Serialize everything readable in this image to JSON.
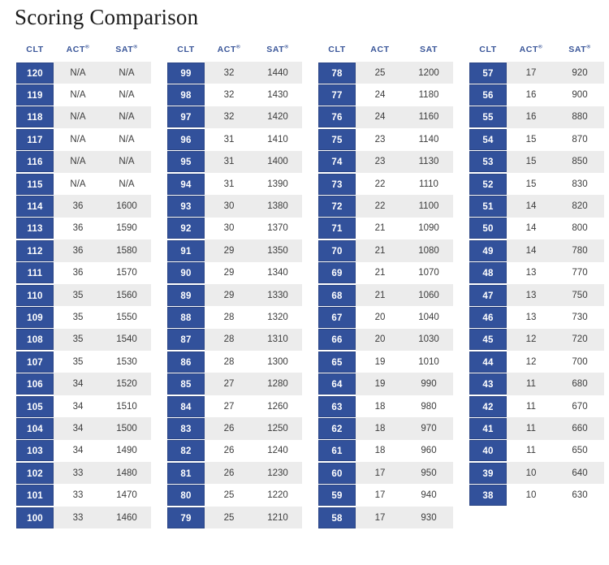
{
  "page": {
    "title": "Scoring Comparison"
  },
  "tables": [
    {
      "id": "table-1",
      "headers": {
        "clt": "CLT",
        "act": "ACT",
        "act_reg": "®",
        "sat": "SAT",
        "sat_reg": "®"
      },
      "act_registered": true,
      "sat_registered": true,
      "rows": [
        {
          "clt": "120",
          "act": "N/A",
          "sat": "N/A"
        },
        {
          "clt": "119",
          "act": "N/A",
          "sat": "N/A"
        },
        {
          "clt": "118",
          "act": "N/A",
          "sat": "N/A"
        },
        {
          "clt": "117",
          "act": "N/A",
          "sat": "N/A"
        },
        {
          "clt": "116",
          "act": "N/A",
          "sat": "N/A"
        },
        {
          "clt": "115",
          "act": "N/A",
          "sat": "N/A"
        },
        {
          "clt": "114",
          "act": "36",
          "sat": "1600"
        },
        {
          "clt": "113",
          "act": "36",
          "sat": "1590"
        },
        {
          "clt": "112",
          "act": "36",
          "sat": "1580"
        },
        {
          "clt": "111",
          "act": "36",
          "sat": "1570"
        },
        {
          "clt": "110",
          "act": "35",
          "sat": "1560"
        },
        {
          "clt": "109",
          "act": "35",
          "sat": "1550"
        },
        {
          "clt": "108",
          "act": "35",
          "sat": "1540"
        },
        {
          "clt": "107",
          "act": "35",
          "sat": "1530"
        },
        {
          "clt": "106",
          "act": "34",
          "sat": "1520"
        },
        {
          "clt": "105",
          "act": "34",
          "sat": "1510"
        },
        {
          "clt": "104",
          "act": "34",
          "sat": "1500"
        },
        {
          "clt": "103",
          "act": "34",
          "sat": "1490"
        },
        {
          "clt": "102",
          "act": "33",
          "sat": "1480"
        },
        {
          "clt": "101",
          "act": "33",
          "sat": "1470"
        },
        {
          "clt": "100",
          "act": "33",
          "sat": "1460"
        }
      ]
    },
    {
      "id": "table-2",
      "headers": {
        "clt": "CLT",
        "act": "ACT",
        "act_reg": "®",
        "sat": "SAT",
        "sat_reg": "®"
      },
      "act_registered": true,
      "sat_registered": true,
      "rows": [
        {
          "clt": "99",
          "act": "32",
          "sat": "1440"
        },
        {
          "clt": "98",
          "act": "32",
          "sat": "1430"
        },
        {
          "clt": "97",
          "act": "32",
          "sat": "1420"
        },
        {
          "clt": "96",
          "act": "31",
          "sat": "1410"
        },
        {
          "clt": "95",
          "act": "31",
          "sat": "1400"
        },
        {
          "clt": "94",
          "act": "31",
          "sat": "1390"
        },
        {
          "clt": "93",
          "act": "30",
          "sat": "1380"
        },
        {
          "clt": "92",
          "act": "30",
          "sat": "1370"
        },
        {
          "clt": "91",
          "act": "29",
          "sat": "1350"
        },
        {
          "clt": "90",
          "act": "29",
          "sat": "1340"
        },
        {
          "clt": "89",
          "act": "29",
          "sat": "1330"
        },
        {
          "clt": "88",
          "act": "28",
          "sat": "1320"
        },
        {
          "clt": "87",
          "act": "28",
          "sat": "1310"
        },
        {
          "clt": "86",
          "act": "28",
          "sat": "1300"
        },
        {
          "clt": "85",
          "act": "27",
          "sat": "1280"
        },
        {
          "clt": "84",
          "act": "27",
          "sat": "1260"
        },
        {
          "clt": "83",
          "act": "26",
          "sat": "1250"
        },
        {
          "clt": "82",
          "act": "26",
          "sat": "1240"
        },
        {
          "clt": "81",
          "act": "26",
          "sat": "1230"
        },
        {
          "clt": "80",
          "act": "25",
          "sat": "1220"
        },
        {
          "clt": "79",
          "act": "25",
          "sat": "1210"
        }
      ]
    },
    {
      "id": "table-3",
      "headers": {
        "clt": "CLT",
        "act": "ACT",
        "act_reg": "",
        "sat": "SAT",
        "sat_reg": ""
      },
      "act_registered": false,
      "sat_registered": false,
      "rows": [
        {
          "clt": "78",
          "act": "25",
          "sat": "1200"
        },
        {
          "clt": "77",
          "act": "24",
          "sat": "1180"
        },
        {
          "clt": "76",
          "act": "24",
          "sat": "1160"
        },
        {
          "clt": "75",
          "act": "23",
          "sat": "1140"
        },
        {
          "clt": "74",
          "act": "23",
          "sat": "1130"
        },
        {
          "clt": "73",
          "act": "22",
          "sat": "1110"
        },
        {
          "clt": "72",
          "act": "22",
          "sat": "1100"
        },
        {
          "clt": "71",
          "act": "21",
          "sat": "1090"
        },
        {
          "clt": "70",
          "act": "21",
          "sat": "1080"
        },
        {
          "clt": "69",
          "act": "21",
          "sat": "1070"
        },
        {
          "clt": "68",
          "act": "21",
          "sat": "1060"
        },
        {
          "clt": "67",
          "act": "20",
          "sat": "1040"
        },
        {
          "clt": "66",
          "act": "20",
          "sat": "1030"
        },
        {
          "clt": "65",
          "act": "19",
          "sat": "1010"
        },
        {
          "clt": "64",
          "act": "19",
          "sat": "990"
        },
        {
          "clt": "63",
          "act": "18",
          "sat": "980"
        },
        {
          "clt": "62",
          "act": "18",
          "sat": "970"
        },
        {
          "clt": "61",
          "act": "18",
          "sat": "960"
        },
        {
          "clt": "60",
          "act": "17",
          "sat": "950"
        },
        {
          "clt": "59",
          "act": "17",
          "sat": "940"
        },
        {
          "clt": "58",
          "act": "17",
          "sat": "930"
        }
      ]
    },
    {
      "id": "table-4",
      "headers": {
        "clt": "CLT",
        "act": "ACT",
        "act_reg": "®",
        "sat": "SAT",
        "sat_reg": "®"
      },
      "act_registered": true,
      "sat_registered": true,
      "rows": [
        {
          "clt": "57",
          "act": "17",
          "sat": "920"
        },
        {
          "clt": "56",
          "act": "16",
          "sat": "900"
        },
        {
          "clt": "55",
          "act": "16",
          "sat": "880"
        },
        {
          "clt": "54",
          "act": "15",
          "sat": "870"
        },
        {
          "clt": "53",
          "act": "15",
          "sat": "850"
        },
        {
          "clt": "52",
          "act": "15",
          "sat": "830"
        },
        {
          "clt": "51",
          "act": "14",
          "sat": "820"
        },
        {
          "clt": "50",
          "act": "14",
          "sat": "800"
        },
        {
          "clt": "49",
          "act": "14",
          "sat": "780"
        },
        {
          "clt": "48",
          "act": "13",
          "sat": "770"
        },
        {
          "clt": "47",
          "act": "13",
          "sat": "750"
        },
        {
          "clt": "46",
          "act": "13",
          "sat": "730"
        },
        {
          "clt": "45",
          "act": "12",
          "sat": "720"
        },
        {
          "clt": "44",
          "act": "12",
          "sat": "700"
        },
        {
          "clt": "43",
          "act": "11",
          "sat": "680"
        },
        {
          "clt": "42",
          "act": "11",
          "sat": "670"
        },
        {
          "clt": "41",
          "act": "11",
          "sat": "660"
        },
        {
          "clt": "40",
          "act": "11",
          "sat": "650"
        },
        {
          "clt": "39",
          "act": "10",
          "sat": "640"
        },
        {
          "clt": "38",
          "act": "10",
          "sat": "630"
        }
      ]
    }
  ],
  "colors": {
    "clt_chip_bg": "#32519b",
    "clt_chip_border": "#2b4585",
    "header_text": "#3a5699",
    "row_alt_bg": "#ececec",
    "row_bg": "#ffffff",
    "body_text": "#3c3c3c",
    "title_text": "#1b1b1b"
  }
}
